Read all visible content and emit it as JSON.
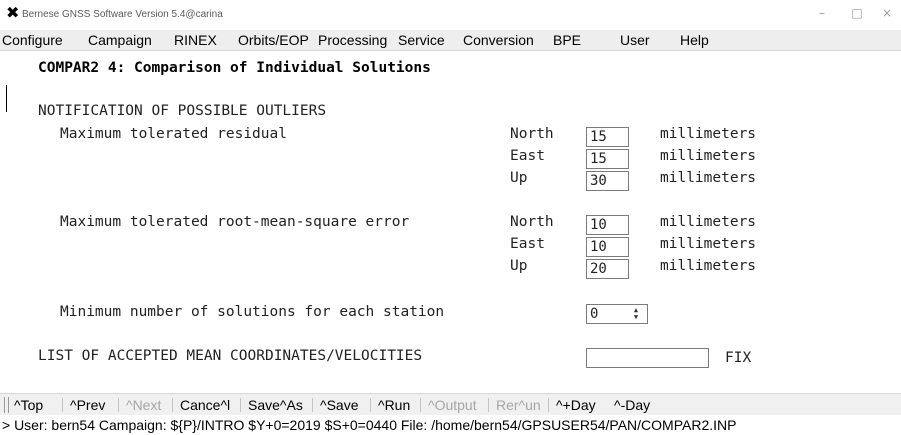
{
  "window": {
    "title": "Bernese GNSS Software Version 5.4@carina",
    "icon": "x-app-icon",
    "controls": {
      "minimize": "–",
      "maximize": "□",
      "close": "×"
    }
  },
  "menu": [
    "Configure",
    "Campaign",
    "RINEX",
    "Orbits/EOP",
    "Processing",
    "Service",
    "Conversion",
    "BPE",
    "User",
    "Help"
  ],
  "panel": {
    "title": "COMPAR2 4: Comparison of Individual Solutions",
    "section_outliers": "NOTIFICATION OF POSSIBLE OUTLIERS",
    "residual": {
      "label": "Maximum tolerated residual",
      "north_label": "North",
      "north_value": "15",
      "east_label": "East",
      "east_value": "15",
      "up_label": "Up",
      "up_value": "30",
      "unit": "millimeters"
    },
    "rms": {
      "label": "Maximum tolerated root-mean-square error",
      "north_label": "North",
      "north_value": "10",
      "east_label": "East",
      "east_value": "10",
      "up_label": "Up",
      "up_value": "20",
      "unit": "millimeters"
    },
    "min_solutions": {
      "label": "Minimum number of solutions for each station",
      "value": "0"
    },
    "accepted_coords": {
      "label": "LIST OF ACCEPTED MEAN COORDINATES/VELOCITIES",
      "value": "",
      "suffix": "FIX"
    }
  },
  "toolbar": {
    "top": "^Top",
    "prev": "^Prev",
    "next": "^Next",
    "cancel": "Cance^l",
    "saveas": "Save^As",
    "save": "^Save",
    "run": "^Run",
    "output": "^Output",
    "rerun": "Rer^un",
    "plusday": "^+Day",
    "minusday": "^-Day"
  },
  "status": "> User: bern54  Campaign: ${P}/INTRO  $Y+0=2019  $S+0=0440  File: /home/bern54/GPSUSER54/PAN/COMPAR2.INP"
}
